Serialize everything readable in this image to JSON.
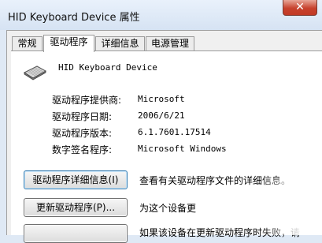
{
  "window": {
    "title": "HID Keyboard Device 属性",
    "close_symbol": "✕"
  },
  "tabs": [
    {
      "label": "常规",
      "active": false
    },
    {
      "label": "驱动程序",
      "active": true
    },
    {
      "label": "详细信息",
      "active": false
    },
    {
      "label": "电源管理",
      "active": false
    }
  ],
  "device": {
    "icon": "keyboard-icon",
    "name": "HID Keyboard Device"
  },
  "properties": [
    {
      "label": "驱动程序提供商:",
      "value": "Microsoft"
    },
    {
      "label": "驱动程序日期:",
      "value": "2006/6/21"
    },
    {
      "label": "驱动程序版本:",
      "value": "6.1.7601.17514"
    },
    {
      "label": "数字签名程序:",
      "value": "Microsoft Windows"
    }
  ],
  "actions": [
    {
      "button": "驱动程序详细信息(I)",
      "description": "查看有关驱动程序文件的详细信息。"
    },
    {
      "button": "更新驱动程序(P)...",
      "description": "为这个设备更"
    },
    {
      "button": "",
      "description": "如果该设备在更新驱动程序时失败，请"
    }
  ]
}
